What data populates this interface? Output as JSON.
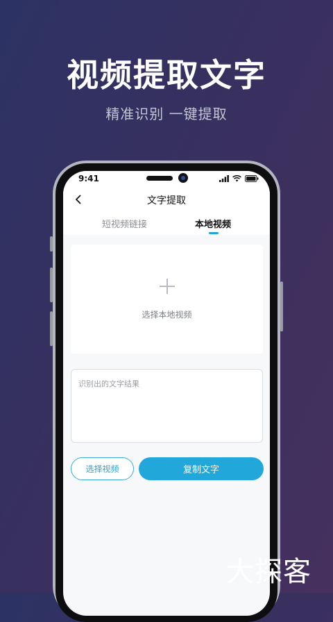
{
  "promo": {
    "title": "视频提取文字",
    "subtitle": "精准识别 一键提取"
  },
  "status_bar": {
    "time": "9:41",
    "icons": [
      "signal-icon",
      "wifi-icon",
      "battery-icon"
    ]
  },
  "nav": {
    "title": "文字提取",
    "back_icon": "chevron-left-icon"
  },
  "tabs": [
    {
      "label": "短视频链接",
      "active": false
    },
    {
      "label": "本地视频",
      "active": true
    }
  ],
  "upload": {
    "icon": "plus-icon",
    "label": "选择本地视频"
  },
  "result": {
    "placeholder": "识别出的文字结果"
  },
  "buttons": {
    "select_label": "选择视频",
    "copy_label": "复制文字"
  },
  "watermark": "大探客",
  "colors": {
    "accent": "#22a7db",
    "background_gradient": [
      "#2c3264",
      "#46305e"
    ]
  }
}
